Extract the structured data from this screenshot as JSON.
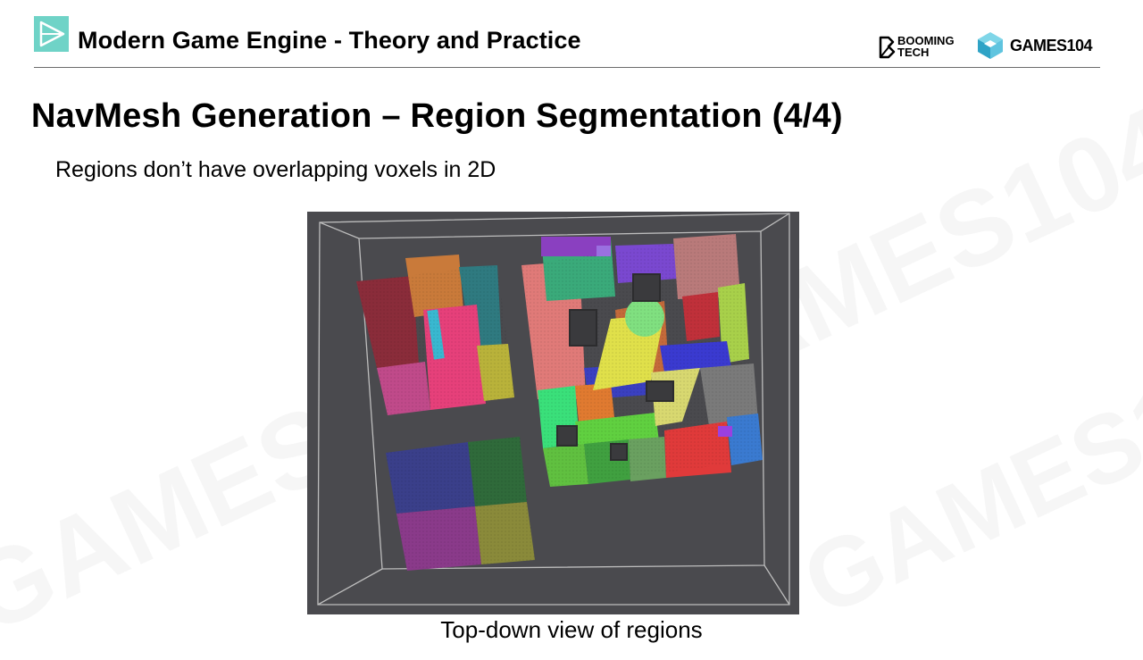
{
  "header": {
    "title": "Modern Game Engine - Theory and Practice",
    "booming_logo": {
      "line1": "BOOMING",
      "line2": "TECH"
    },
    "games_logo": {
      "text": "GAMES104"
    }
  },
  "slide": {
    "title": "NavMesh Generation – Region Segmentation (4/4)",
    "bullet": "Regions don’t have overlapping voxels in 2D",
    "figure_caption": "Top-down view of regions"
  },
  "icons": {
    "header": "play-triangle-icon",
    "booming": "booming-b-icon",
    "games": "games-cube-icon"
  },
  "colors": {
    "header_icon": "#6fd3c7",
    "figure_background": "#4a4a4e",
    "rule": "#6b6b6b"
  }
}
